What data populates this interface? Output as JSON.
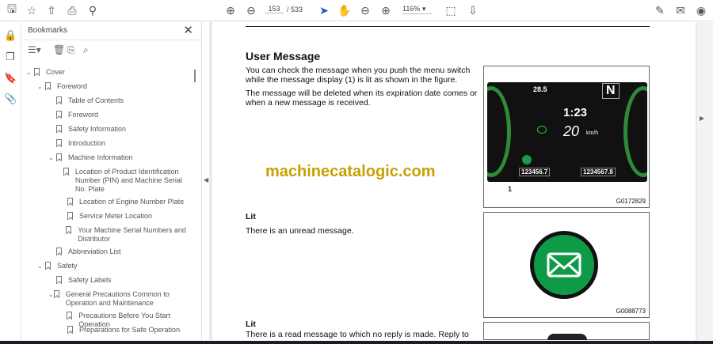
{
  "toolbar": {
    "page_current": "153",
    "page_total": "/ 533",
    "zoom": "116%"
  },
  "bookmarks": {
    "title": "Bookmarks",
    "items": [
      {
        "label": "Cover"
      },
      {
        "label": "Foreword"
      },
      {
        "label": "Table of Contents"
      },
      {
        "label": "Foreword"
      },
      {
        "label": "Safety Information"
      },
      {
        "label": "Introduction"
      },
      {
        "label": "Machine Information"
      },
      {
        "label": "Location of Product Identification Number (PIN) and Machine Serial No. Plate"
      },
      {
        "label": "Location of Engine Number Plate"
      },
      {
        "label": "Service Meter Location"
      },
      {
        "label": "Your Machine Serial Numbers and Distributor"
      },
      {
        "label": "Abbreviation List"
      },
      {
        "label": "Safety"
      },
      {
        "label": "Safety Labels"
      },
      {
        "label": "General Precautions Common to Operation and Maintenance"
      },
      {
        "label": "Precautions Before You Start Operation"
      },
      {
        "label": "Preparations for Safe Operation"
      }
    ]
  },
  "document": {
    "heading": "User Message",
    "para1": "You can check the message when you push the menu switch while the message display (1) is lit as shown in the figure.",
    "para2": "The message will be deleted when its expiration date comes or when a new message is received.",
    "fig1": {
      "caption": "G0172829",
      "callout": "1",
      "temp": "28.5",
      "gear": "N",
      "time": "1:23",
      "speed": "20",
      "speed_unit": "km/h",
      "odo1": "123456.7",
      "odo2": "1234567.8"
    },
    "watermark": "machinecatalogic.com",
    "lit1_title": "Lit",
    "lit1_text": "There is an unread message.",
    "fig2": {
      "caption": "G0088773"
    },
    "lit2_title": "Lit",
    "lit2_text": "There is a read message to which no reply is made. Reply to"
  }
}
